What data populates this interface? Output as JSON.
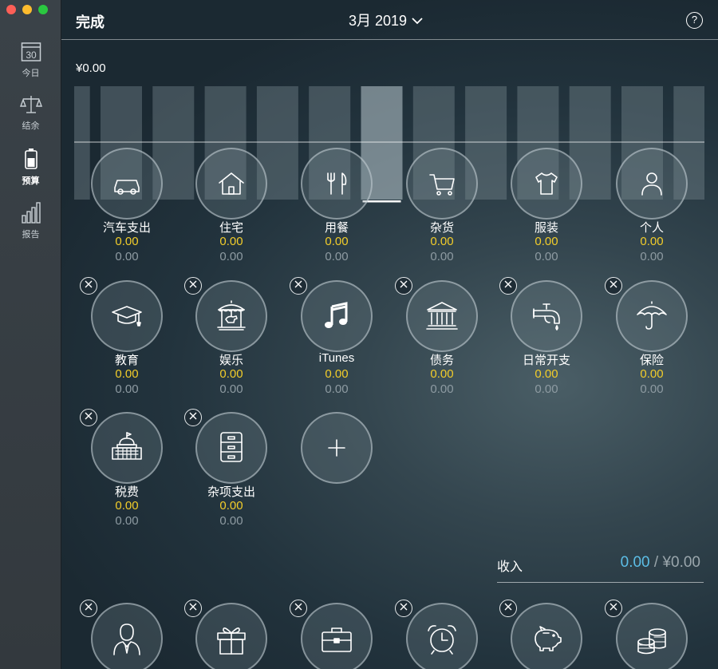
{
  "window": {
    "controls": [
      "close",
      "minimize",
      "zoom"
    ]
  },
  "sidebar": {
    "items": [
      {
        "label": "今日",
        "icon": "calendar-icon",
        "icon_text": "30",
        "active": false
      },
      {
        "label": "结余",
        "icon": "scale-icon",
        "active": false
      },
      {
        "label": "预算",
        "icon": "battery-icon",
        "active": true
      },
      {
        "label": "报告",
        "icon": "bar-chart-icon",
        "active": false
      }
    ]
  },
  "header": {
    "done_label": "完成",
    "month": "3月 2019",
    "help": "?"
  },
  "budget": {
    "total": "¥0.00"
  },
  "chart_data": {
    "type": "bar",
    "bar_count": 13,
    "selected_index": 5,
    "values": [
      0,
      0,
      0,
      0,
      0,
      0,
      0,
      0,
      0,
      0,
      0,
      0,
      0
    ]
  },
  "expense_categories": [
    {
      "name": "汽车支出",
      "budget": "0.00",
      "spent": "0.00",
      "icon": "car-icon"
    },
    {
      "name": "住宅",
      "budget": "0.00",
      "spent": "0.00",
      "icon": "house-icon"
    },
    {
      "name": "用餐",
      "budget": "0.00",
      "spent": "0.00",
      "icon": "dining-icon"
    },
    {
      "name": "杂货",
      "budget": "0.00",
      "spent": "0.00",
      "icon": "cart-icon"
    },
    {
      "name": "服装",
      "budget": "0.00",
      "spent": "0.00",
      "icon": "shirt-icon"
    },
    {
      "name": "个人",
      "budget": "0.00",
      "spent": "0.00",
      "icon": "person-icon"
    },
    {
      "name": "教育",
      "budget": "0.00",
      "spent": "0.00",
      "icon": "graduation-cap-icon"
    },
    {
      "name": "娱乐",
      "budget": "0.00",
      "spent": "0.00",
      "icon": "carousel-icon"
    },
    {
      "name": "iTunes",
      "budget": "0.00",
      "spent": "0.00",
      "icon": "music-note-icon"
    },
    {
      "name": "债务",
      "budget": "0.00",
      "spent": "0.00",
      "icon": "bank-icon"
    },
    {
      "name": "日常开支",
      "budget": "0.00",
      "spent": "0.00",
      "icon": "faucet-icon"
    },
    {
      "name": "保险",
      "budget": "0.00",
      "spent": "0.00",
      "icon": "umbrella-icon"
    },
    {
      "name": "税费",
      "budget": "0.00",
      "spent": "0.00",
      "icon": "capitol-icon"
    },
    {
      "name": "杂项支出",
      "budget": "0.00",
      "spent": "0.00",
      "icon": "cabinet-icon"
    }
  ],
  "income": {
    "label": "收入",
    "budget": "0.00",
    "separator": " / ",
    "total": "¥0.00"
  },
  "income_categories": [
    {
      "icon": "businessman-icon"
    },
    {
      "icon": "gift-icon"
    },
    {
      "icon": "briefcase-icon"
    },
    {
      "icon": "alarm-clock-icon"
    },
    {
      "icon": "piggy-bank-icon"
    },
    {
      "icon": "coins-icon"
    }
  ],
  "add_button": {
    "icon": "plus-icon"
  }
}
